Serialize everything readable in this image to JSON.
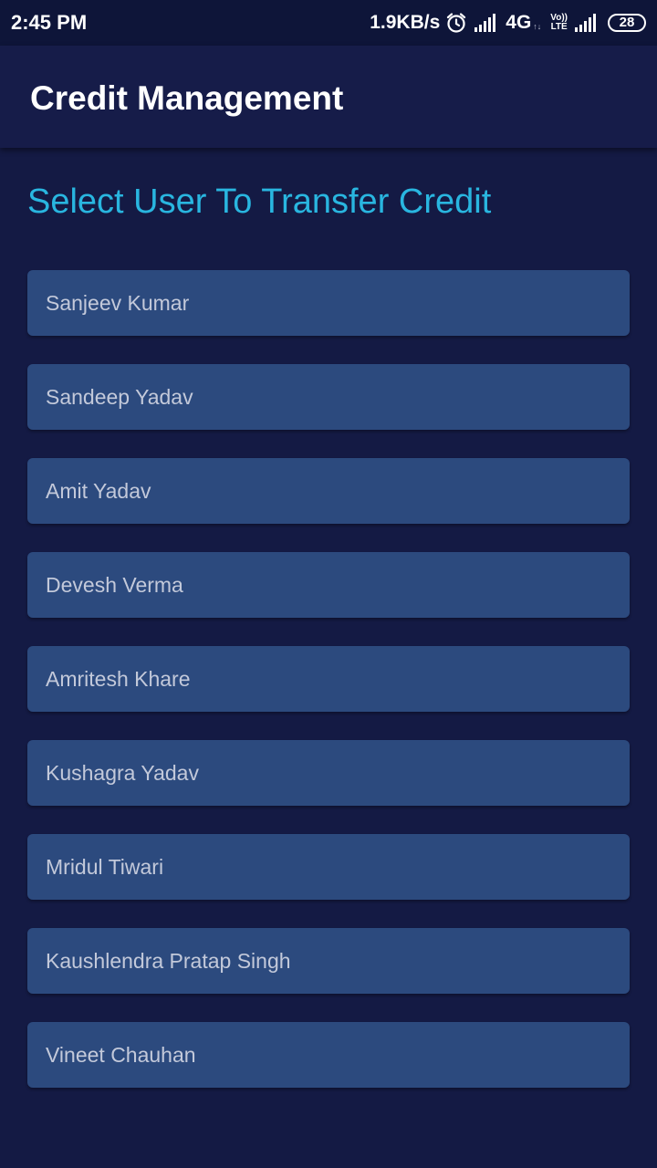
{
  "status_bar": {
    "time": "2:45 PM",
    "net_speed": "1.9KB/s",
    "network_type": "4G",
    "volte_top": "Vo))",
    "volte_bottom": "LTE",
    "battery": "28",
    "icons": [
      "alarm-icon",
      "signal-icon",
      "volte-icon",
      "signal-icon",
      "battery-icon"
    ]
  },
  "app_bar": {
    "title": "Credit Management"
  },
  "main": {
    "heading": "Select User To Transfer Credit",
    "users": [
      {
        "name": "Sanjeev Kumar"
      },
      {
        "name": "Sandeep Yadav"
      },
      {
        "name": "Amit Yadav"
      },
      {
        "name": "Devesh Verma"
      },
      {
        "name": "Amritesh Khare"
      },
      {
        "name": "Kushagra Yadav"
      },
      {
        "name": "Mridul Tiwari"
      },
      {
        "name": "Kaushlendra Pratap Singh"
      },
      {
        "name": "Vineet Chauhan"
      }
    ]
  },
  "colors": {
    "background": "#141a44",
    "app_bar": "#161c49",
    "status_bar": "#0e1539",
    "heading": "#29b6e0",
    "card": "#2c4a7e",
    "card_text": "#c3c9da"
  }
}
